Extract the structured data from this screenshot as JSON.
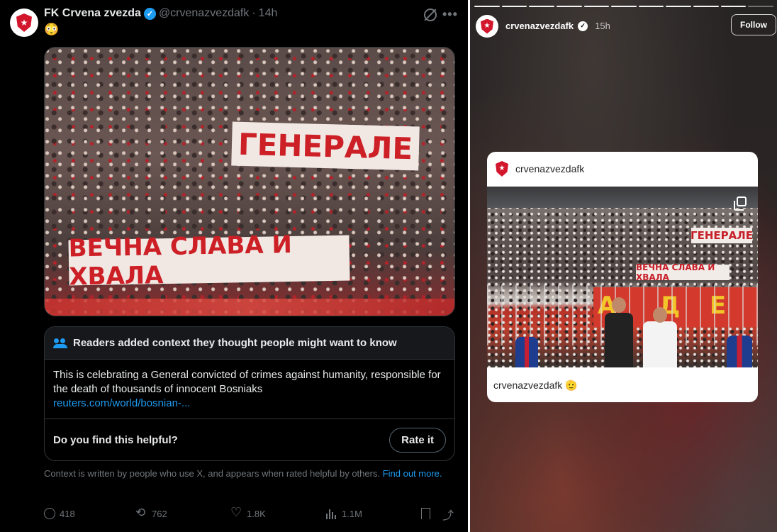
{
  "tweet": {
    "display_name": "FK Crvena zvezda",
    "handle": "@crvenazvezdafk",
    "separator": "·",
    "time": "14h",
    "text": "😳",
    "avatar_crest": "★",
    "more_glyph": "•••",
    "media": {
      "banner_top": "ГЕНЕРАЛЕ",
      "banner_bottom": "ВЕЧНА СЛАВА И ХВАЛА"
    },
    "community_note": {
      "header": "Readers added context they thought people might want to know",
      "body": "This is celebrating a General convicted of crimes against humanity, responsible for the death of thousands of innocent Bosniaks",
      "link": "reuters.com/world/bosnian-...",
      "question": "Do you find this helpful?",
      "rate_label": "Rate it"
    },
    "context_text": "Context is written by people who use X, and appears when rated helpful by others.",
    "find_out_more": "Find out more.",
    "actions": {
      "replies": "418",
      "reposts": "762",
      "likes": "1.8K",
      "views": "1.1M"
    }
  },
  "story": {
    "progress": {
      "segments": 11,
      "viewed": 10
    },
    "username": "crvenazvezdafk",
    "time": "15h",
    "follow_label": "Follow",
    "verified_glyph": "✓",
    "card": {
      "username": "crvenazvezdafk",
      "banner_top": "ГЕНЕРАЛЕ",
      "banner_bottom": "ВЕЧНА СЛАВА И ХВАЛА",
      "caption": "crvenazvezdafk 🫡"
    }
  },
  "colors": {
    "x_blue": "#1d9bf0",
    "zvezda_red": "#d2162c"
  }
}
